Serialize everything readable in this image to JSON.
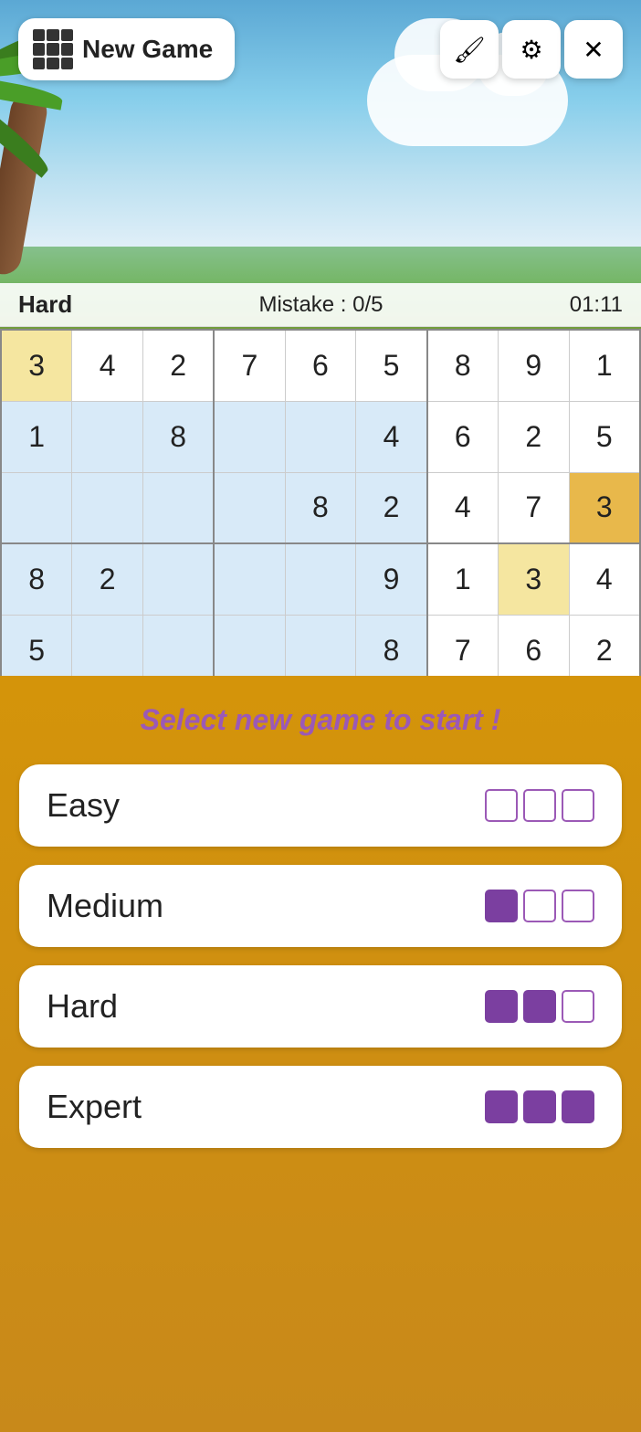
{
  "header": {
    "new_game_label": "New Game",
    "paint_icon": "🖌",
    "settings_icon": "⚙",
    "close_icon": "✕"
  },
  "status": {
    "difficulty": "Hard",
    "mistakes_label": "Mistake : 0/5",
    "timer": "01:11"
  },
  "grid": {
    "rows": [
      [
        {
          "val": "3",
          "cls": "cell-yellow"
        },
        {
          "val": "4",
          "cls": ""
        },
        {
          "val": "2",
          "cls": ""
        },
        {
          "val": "7",
          "cls": ""
        },
        {
          "val": "6",
          "cls": ""
        },
        {
          "val": "5",
          "cls": ""
        },
        {
          "val": "8",
          "cls": ""
        },
        {
          "val": "9",
          "cls": ""
        },
        {
          "val": "1",
          "cls": ""
        }
      ],
      [
        {
          "val": "1",
          "cls": "cell-highlight"
        },
        {
          "val": "",
          "cls": "cell-highlight"
        },
        {
          "val": "8",
          "cls": "cell-highlight"
        },
        {
          "val": "",
          "cls": "cell-highlight"
        },
        {
          "val": "",
          "cls": "cell-highlight"
        },
        {
          "val": "4",
          "cls": "cell-highlight"
        },
        {
          "val": "6",
          "cls": ""
        },
        {
          "val": "2",
          "cls": ""
        },
        {
          "val": "5",
          "cls": ""
        }
      ],
      [
        {
          "val": "",
          "cls": "cell-highlight"
        },
        {
          "val": "",
          "cls": "cell-highlight"
        },
        {
          "val": "",
          "cls": "cell-highlight"
        },
        {
          "val": "",
          "cls": "cell-highlight"
        },
        {
          "val": "8",
          "cls": "cell-highlight"
        },
        {
          "val": "2",
          "cls": "cell-highlight"
        },
        {
          "val": "4",
          "cls": ""
        },
        {
          "val": "7",
          "cls": ""
        },
        {
          "val": "3",
          "cls": "cell-gold"
        }
      ],
      [
        {
          "val": "8",
          "cls": "cell-highlight"
        },
        {
          "val": "2",
          "cls": "cell-highlight"
        },
        {
          "val": "",
          "cls": "cell-highlight"
        },
        {
          "val": "",
          "cls": "cell-highlight"
        },
        {
          "val": "",
          "cls": "cell-highlight"
        },
        {
          "val": "9",
          "cls": "cell-highlight"
        },
        {
          "val": "1",
          "cls": ""
        },
        {
          "val": "3",
          "cls": "cell-yellow"
        },
        {
          "val": "4",
          "cls": ""
        }
      ],
      [
        {
          "val": "5",
          "cls": "cell-highlight"
        },
        {
          "val": "",
          "cls": "cell-highlight"
        },
        {
          "val": "",
          "cls": "cell-highlight"
        },
        {
          "val": "",
          "cls": "cell-highlight"
        },
        {
          "val": "",
          "cls": "cell-highlight"
        },
        {
          "val": "8",
          "cls": "cell-highlight"
        },
        {
          "val": "7",
          "cls": ""
        },
        {
          "val": "6",
          "cls": ""
        },
        {
          "val": "2",
          "cls": ""
        }
      ]
    ]
  },
  "overlay": {
    "prompt": "Select new game to start !",
    "options": [
      {
        "label": "Easy",
        "bars": [
          false,
          false,
          false
        ]
      },
      {
        "label": "Medium",
        "bars": [
          true,
          false,
          false
        ]
      },
      {
        "label": "Hard",
        "bars": [
          true,
          true,
          false
        ]
      },
      {
        "label": "Expert",
        "bars": [
          true,
          true,
          true
        ]
      }
    ]
  }
}
